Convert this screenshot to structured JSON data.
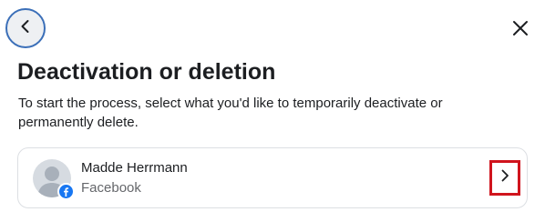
{
  "header": {
    "back_icon": "chevron-left-icon",
    "close_icon": "close-icon"
  },
  "main": {
    "title": "Deactivation or deletion",
    "description": "To start the process, select what you'd like to temporarily deactivate or permanently delete."
  },
  "account": {
    "name": "Madde Herrmann",
    "platform": "Facebook",
    "avatar_icon": "default-avatar-icon",
    "badge_icon": "facebook-icon",
    "chevron_icon": "chevron-right-icon",
    "highlight_color": "#d0141d",
    "brand_color": "#1877f2"
  }
}
